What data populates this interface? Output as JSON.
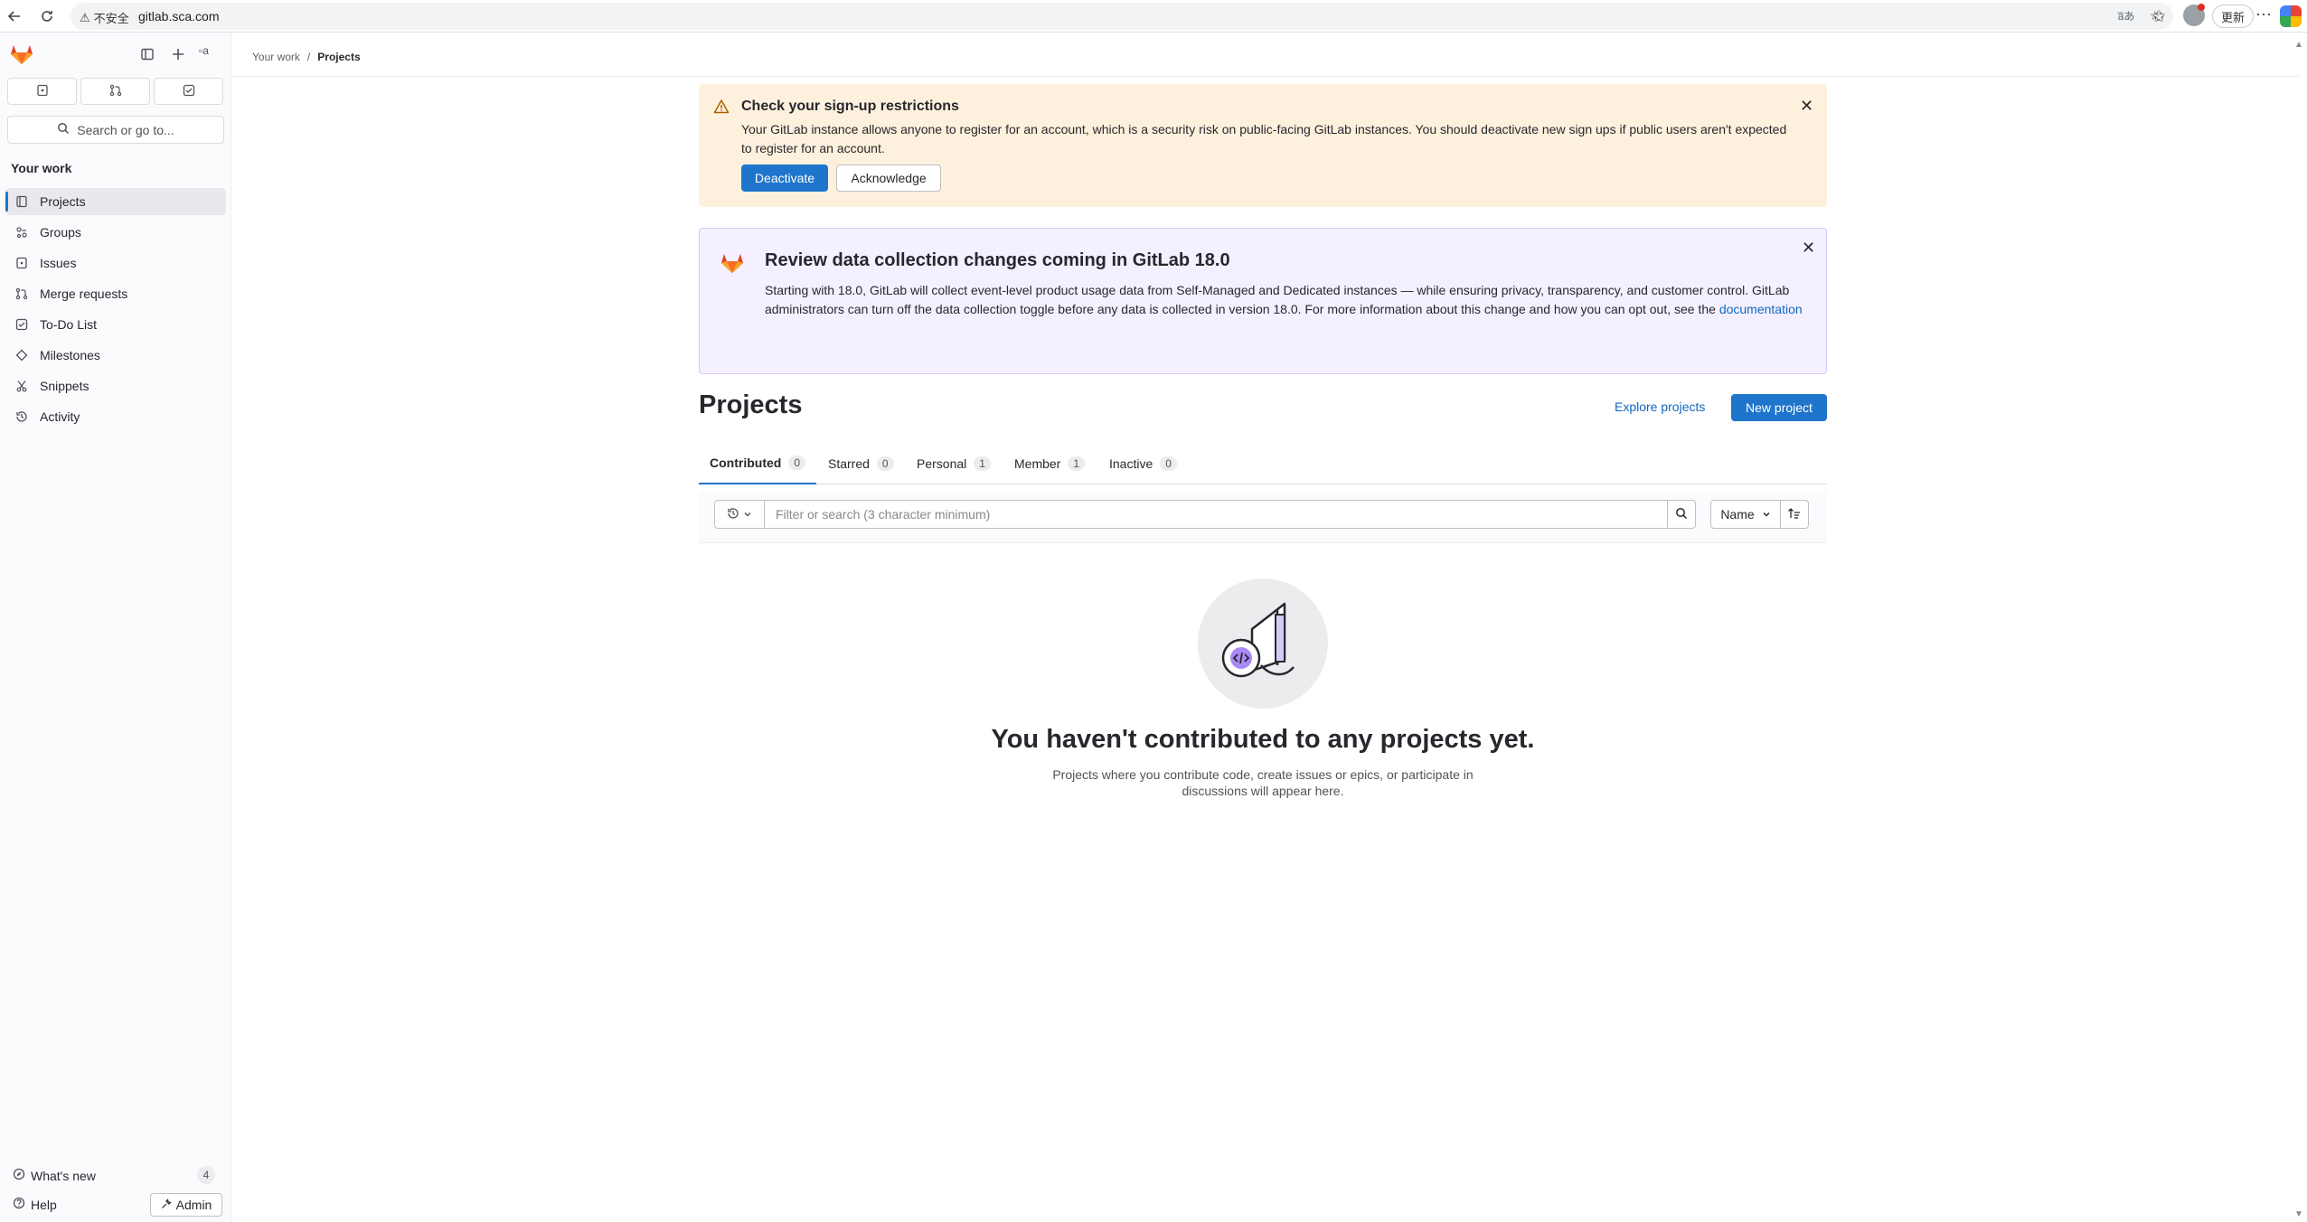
{
  "browser": {
    "security_label": "不安全",
    "url": "gitlab.sca.com",
    "update_label": "更新"
  },
  "sidebar": {
    "broken_image_alt": "a",
    "search_label": "Search or go to...",
    "section_title": "Your work",
    "items": [
      {
        "label": "Projects",
        "icon": "project-icon",
        "active": true
      },
      {
        "label": "Groups",
        "icon": "group-icon"
      },
      {
        "label": "Issues",
        "icon": "issues-icon"
      },
      {
        "label": "Merge requests",
        "icon": "merge-request-icon"
      },
      {
        "label": "To-Do List",
        "icon": "todo-icon"
      },
      {
        "label": "Milestones",
        "icon": "milestone-icon"
      },
      {
        "label": "Snippets",
        "icon": "snippet-icon"
      },
      {
        "label": "Activity",
        "icon": "history-icon"
      }
    ],
    "whats_new": "What's new",
    "whats_new_count": "4",
    "help": "Help",
    "admin": "Admin"
  },
  "breadcrumb": {
    "parent": "Your work",
    "separator": "/",
    "current": "Projects"
  },
  "signup_alert": {
    "title": "Check your sign-up restrictions",
    "body": "Your GitLab instance allows anyone to register for an account, which is a security risk on public-facing GitLab instances. You should deactivate new sign ups if public users aren't expected to register for an account.",
    "primary": "Deactivate",
    "secondary": "Acknowledge"
  },
  "data_alert": {
    "title": "Review data collection changes coming in GitLab 18.0",
    "body": "Starting with 18.0, GitLab will collect event-level product usage data from Self-Managed and Dedicated instances — while ensuring privacy, transparency, and customer control. GitLab administrators can turn off the data collection toggle before any data is collected in version 18.0. For more information about this change and how you can opt out, see the",
    "link": "documentation"
  },
  "projects": {
    "title": "Projects",
    "explore": "Explore projects",
    "new_project": "New project",
    "tabs": [
      {
        "label": "Contributed",
        "count": "0",
        "active": true
      },
      {
        "label": "Starred",
        "count": "0"
      },
      {
        "label": "Personal",
        "count": "1"
      },
      {
        "label": "Member",
        "count": "1"
      },
      {
        "label": "Inactive",
        "count": "0"
      }
    ],
    "filter_placeholder": "Filter or search (3 character minimum)",
    "sort_label": "Name",
    "empty_title": "You haven't contributed to any projects yet.",
    "empty_desc": "Projects where you contribute code, create issues or epics, or participate in discussions will appear here."
  },
  "colors": {
    "primary": "#1f75cb",
    "warning_bg": "#fdf1dd",
    "promo_bg": "#f4f0ff",
    "gitlab_orange": "#e24329"
  }
}
